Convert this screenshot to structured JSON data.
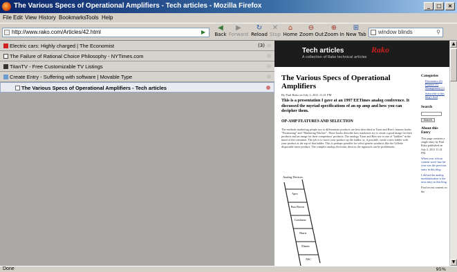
{
  "window": {
    "title": "The Various Specs of Operational Amplifiers - Tech articles - Mozilla Firefox"
  },
  "menu": [
    "File",
    "Edit",
    "View",
    "History",
    "Bookmarks",
    "Tools",
    "Help"
  ],
  "nav": {
    "url": "http://www.rako.com/Articles/42.html",
    "buttons": {
      "back": "Back",
      "forward": "Forward",
      "reload": "Reload",
      "stop": "Stop",
      "home": "Home",
      "zoom_out": "Zoom Out",
      "zoom_in": "Zoom In",
      "new_tab": "New Tab"
    },
    "search_query": "window blinds"
  },
  "tabs": [
    {
      "label": "Electric cars: Highly charged | The Economist",
      "count": "(3)",
      "selected": false,
      "icon": "economist-icon"
    },
    {
      "label": "The Failure of Rational Choice Philosophy - NYTimes.com",
      "count": "",
      "selected": false,
      "icon": "nytimes-icon"
    },
    {
      "label": "TitanTV - Free Customizable TV Listings",
      "count": "",
      "selected": false,
      "icon": "titantv-icon"
    },
    {
      "label": "Create Entry - Suffering with software | Movable Type",
      "count": "",
      "selected": false,
      "icon": "movabletype-icon"
    },
    {
      "label": "The Various Specs of Operational Amplifiers - Tech articles",
      "count": "",
      "selected": true,
      "icon": "page-icon"
    }
  ],
  "site": {
    "title": "Tech articles",
    "tagline": "A collection of Rako technical articles",
    "logo": "Rako"
  },
  "article": {
    "title": "The Various Specs of Operational Amplifiers",
    "meta": "By Paul Rako on July 2, 2011 11:41 PM",
    "lead": "This is a presentation I gave at an 1997 EETimes analog conference. It discussed the myriad specifications of an op amp and how you can decipher them.",
    "section": "OP-AMP FEATURES AND SELECTION",
    "body": "The methods marketing people use to differentiate products are best described as Trout and Ries's famous books \"Positioning\" and \"Marketing Warfare\". These books describe how marketers try to create a good image for their products and an image for their competitors' products. The analogy Trout and Ries use is one of \"ladders\" in the mind of the consumer. The job is to move your product up the ladder, or, if possible, create a new ladder with your product at the top of that ladder. This is perhaps possible for select generic products like the Gillette disposable razor product. The complex analog electronic devices the approach can be problematic.",
    "ladder_caption": "Analog Devices",
    "ladder_rungs": [
      "Apex",
      "Burr Brown",
      "Comlinear",
      "Harris",
      "Elantec",
      "NSC"
    ]
  },
  "sidebar": {
    "categories_heading": "Categories",
    "categories": [
      "Electronics (2)",
      "Finance (1)",
      "Management (1)",
      "Subscribe to this blog's feed"
    ],
    "search_heading": "Search",
    "search_button": "Search",
    "about_heading": "About this Entry",
    "about_text": "This page contains a single entry by Paul Rako published on July 2, 2011 11:41 PM.",
    "prev_text": "When your silicon content won't last the year was the previous entry in this blog.",
    "next_text": "I did not the analog modularization is the next entry in this blog.",
    "recent_text": "Find recent content on the"
  },
  "status": {
    "text": "Done",
    "zoom": "95%"
  },
  "colors": {
    "title_bar": "#0a246a",
    "site_header": "#1c1c1c",
    "logo": "#c81e1e",
    "link": "#1a3c9c"
  }
}
